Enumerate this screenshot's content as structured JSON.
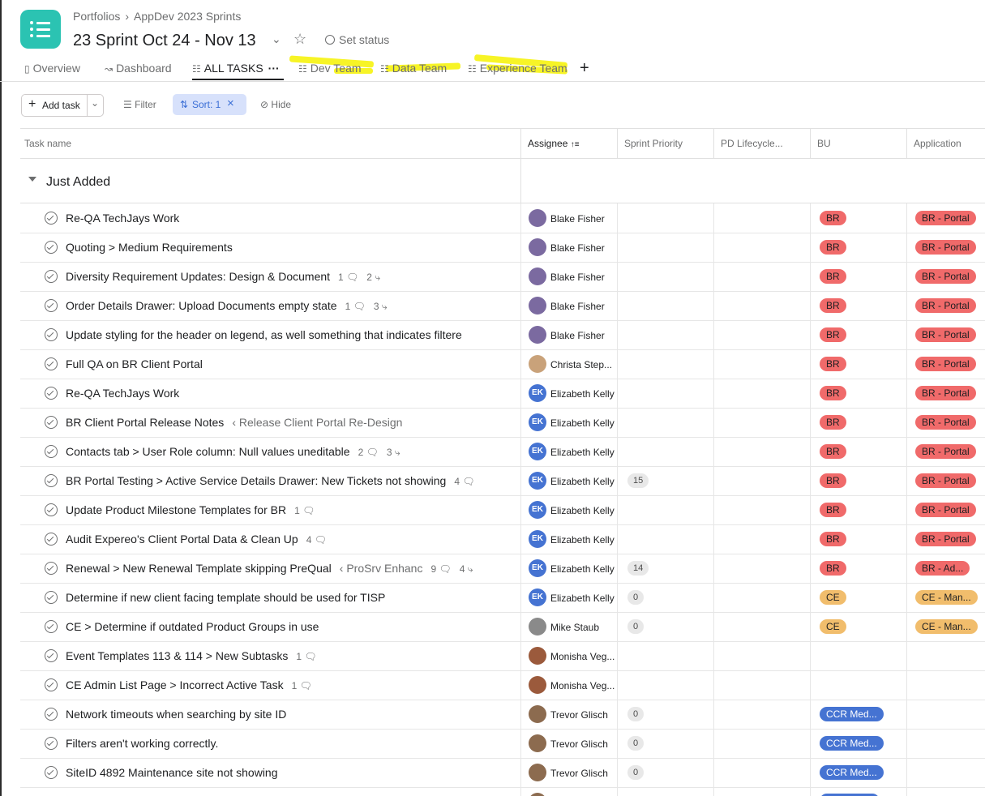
{
  "breadcrumb": {
    "portfolio_label": "Portfolios",
    "sep": "›",
    "parent": "AppDev 2023 Sprints"
  },
  "project": {
    "title": "23 Sprint Oct 24 - Nov 13",
    "set_status": "Set status"
  },
  "tabs": [
    {
      "label": "Overview",
      "icon": "overview-icon"
    },
    {
      "label": "Dashboard",
      "icon": "dashboard-icon"
    },
    {
      "label": "ALL TASKS",
      "icon": "list-icon"
    },
    {
      "label": "Dev Team",
      "icon": "list-icon"
    },
    {
      "label": "Data Team",
      "icon": "list-icon"
    },
    {
      "label": "Experience Team",
      "icon": "list-icon"
    }
  ],
  "tab_more": "···",
  "add_tab": "+",
  "toolbar": {
    "add_task": "Add task",
    "filter": "Filter",
    "sort": "Sort: 1",
    "hide": "Hide"
  },
  "columns": {
    "task": "Task name",
    "assignee": "Assignee",
    "priority": "Sprint Priority",
    "lifecycle": "PD Lifecycle...",
    "bu": "BU",
    "application": "Application"
  },
  "section_title": "Just Added",
  "colors": {
    "br_red": "#f06a6a",
    "ce_orange": "#f1bd6c",
    "ccr_blue": "#4573d2",
    "ek_blue": "#4573d2",
    "highlight": "#f6f200"
  },
  "rows": [
    {
      "task": "Re-QA TechJays Work",
      "parent": "",
      "comments": "",
      "subtasks": "",
      "assignee": "Blake Fisher",
      "initials": "",
      "avatar_color": "#7b6aa0",
      "priority": "",
      "bu": "BR",
      "bu_kind": "br",
      "app": "BR - Portal",
      "app_kind": "br"
    },
    {
      "task": "Quoting > Medium Requirements",
      "parent": "",
      "comments": "",
      "subtasks": "",
      "assignee": "Blake Fisher",
      "initials": "",
      "avatar_color": "#7b6aa0",
      "priority": "",
      "bu": "BR",
      "bu_kind": "br",
      "app": "BR - Portal",
      "app_kind": "br"
    },
    {
      "task": "Diversity Requirement Updates: Design & Document",
      "parent": "",
      "comments": "1",
      "subtasks": "2",
      "assignee": "Blake Fisher",
      "initials": "",
      "avatar_color": "#7b6aa0",
      "priority": "",
      "bu": "BR",
      "bu_kind": "br",
      "app": "BR - Portal",
      "app_kind": "br"
    },
    {
      "task": "Order Details Drawer: Upload Documents empty state",
      "parent": "",
      "comments": "1",
      "subtasks": "3",
      "assignee": "Blake Fisher",
      "initials": "",
      "avatar_color": "#7b6aa0",
      "priority": "",
      "bu": "BR",
      "bu_kind": "br",
      "app": "BR - Portal",
      "app_kind": "br"
    },
    {
      "task": "Update styling for the header on legend, as well something that indicates filtere",
      "parent": "",
      "comments": "",
      "subtasks": "",
      "assignee": "Blake Fisher",
      "initials": "",
      "avatar_color": "#7b6aa0",
      "priority": "",
      "bu": "BR",
      "bu_kind": "br",
      "app": "BR - Portal",
      "app_kind": "br"
    },
    {
      "task": "Full QA on BR Client Portal",
      "parent": "",
      "comments": "",
      "subtasks": "",
      "assignee": "Christa Step...",
      "initials": "",
      "avatar_color": "#c9a27a",
      "priority": "",
      "bu": "BR",
      "bu_kind": "br",
      "app": "BR - Portal",
      "app_kind": "br"
    },
    {
      "task": "Re-QA TechJays Work",
      "parent": "",
      "comments": "",
      "subtasks": "",
      "assignee": "Elizabeth Kelly",
      "initials": "EK",
      "avatar_color": "#4573d2",
      "priority": "",
      "bu": "BR",
      "bu_kind": "br",
      "app": "BR - Portal",
      "app_kind": "br"
    },
    {
      "task": "BR Client Portal Release Notes",
      "parent": "Release Client Portal Re-Design",
      "comments": "",
      "subtasks": "",
      "assignee": "Elizabeth Kelly",
      "initials": "EK",
      "avatar_color": "#4573d2",
      "priority": "",
      "bu": "BR",
      "bu_kind": "br",
      "app": "BR - Portal",
      "app_kind": "br"
    },
    {
      "task": "Contacts tab > User Role column: Null values uneditable",
      "parent": "",
      "comments": "2",
      "subtasks": "3",
      "assignee": "Elizabeth Kelly",
      "initials": "EK",
      "avatar_color": "#4573d2",
      "priority": "",
      "bu": "BR",
      "bu_kind": "br",
      "app": "BR - Portal",
      "app_kind": "br"
    },
    {
      "task": "BR Portal Testing > Active Service Details Drawer: New Tickets not showing",
      "parent": "",
      "comments": "4",
      "subtasks": "",
      "assignee": "Elizabeth Kelly",
      "initials": "EK",
      "avatar_color": "#4573d2",
      "priority": "15",
      "bu": "BR",
      "bu_kind": "br",
      "app": "BR - Portal",
      "app_kind": "br"
    },
    {
      "task": "Update Product Milestone Templates for BR",
      "parent": "",
      "comments": "1",
      "subtasks": "",
      "assignee": "Elizabeth Kelly",
      "initials": "EK",
      "avatar_color": "#4573d2",
      "priority": "",
      "bu": "BR",
      "bu_kind": "br",
      "app": "BR - Portal",
      "app_kind": "br"
    },
    {
      "task": "Audit Expereo's Client Portal Data & Clean Up",
      "parent": "",
      "comments": "4",
      "subtasks": "",
      "assignee": "Elizabeth Kelly",
      "initials": "EK",
      "avatar_color": "#4573d2",
      "priority": "",
      "bu": "BR",
      "bu_kind": "br",
      "app": "BR - Portal",
      "app_kind": "br"
    },
    {
      "task": "Renewal > New Renewal Template skipping PreQual",
      "parent": "ProSrv Enhanc",
      "comments": "9",
      "subtasks": "4",
      "assignee": "Elizabeth Kelly",
      "initials": "EK",
      "avatar_color": "#4573d2",
      "priority": "14",
      "bu": "BR",
      "bu_kind": "br",
      "app": "BR - Ad...",
      "app_kind": "br"
    },
    {
      "task": "Determine if new client facing template should be used for TISP",
      "parent": "",
      "comments": "",
      "subtasks": "",
      "assignee": "Elizabeth Kelly",
      "initials": "EK",
      "avatar_color": "#4573d2",
      "priority": "0",
      "bu": "CE",
      "bu_kind": "ce",
      "app": "CE - Man...",
      "app_kind": "ce"
    },
    {
      "task": "CE > Determine if outdated Product Groups in use",
      "parent": "",
      "comments": "",
      "subtasks": "",
      "assignee": "Mike Staub",
      "initials": "",
      "avatar_color": "#8a8a8a",
      "priority": "0",
      "bu": "CE",
      "bu_kind": "ce",
      "app": "CE - Man...",
      "app_kind": "ce"
    },
    {
      "task": "Event Templates 113 & 114 > New Subtasks",
      "parent": "",
      "comments": "1",
      "subtasks": "",
      "assignee": "Monisha Veg...",
      "initials": "",
      "avatar_color": "#9b5a3c",
      "priority": "",
      "bu": "",
      "bu_kind": "",
      "app": "",
      "app_kind": ""
    },
    {
      "task": "CE Admin List Page > Incorrect Active Task",
      "parent": "",
      "comments": "1",
      "subtasks": "",
      "assignee": "Monisha Veg...",
      "initials": "",
      "avatar_color": "#9b5a3c",
      "priority": "",
      "bu": "",
      "bu_kind": "",
      "app": "",
      "app_kind": ""
    },
    {
      "task": "Network timeouts when searching by site ID",
      "parent": "",
      "comments": "",
      "subtasks": "",
      "assignee": "Trevor Glisch",
      "initials": "",
      "avatar_color": "#8c6b4f",
      "priority": "0",
      "bu": "CCR Med...",
      "bu_kind": "ccr",
      "app": "",
      "app_kind": ""
    },
    {
      "task": "Filters aren't working correctly.",
      "parent": "",
      "comments": "",
      "subtasks": "",
      "assignee": "Trevor Glisch",
      "initials": "",
      "avatar_color": "#8c6b4f",
      "priority": "0",
      "bu": "CCR Med...",
      "bu_kind": "ccr",
      "app": "",
      "app_kind": ""
    },
    {
      "task": "SiteID 4892 Maintenance site not showing",
      "parent": "",
      "comments": "",
      "subtasks": "",
      "assignee": "Trevor Glisch",
      "initials": "",
      "avatar_color": "#8c6b4f",
      "priority": "0",
      "bu": "CCR Med...",
      "bu_kind": "ccr",
      "app": "",
      "app_kind": ""
    },
    {
      "task": "",
      "parent": "",
      "comments": "",
      "subtasks": "",
      "assignee": "",
      "initials": "",
      "avatar_color": "#8c6b4f",
      "priority": "",
      "bu": "",
      "bu_kind": "ccr-partial",
      "app": "",
      "app_kind": ""
    }
  ]
}
